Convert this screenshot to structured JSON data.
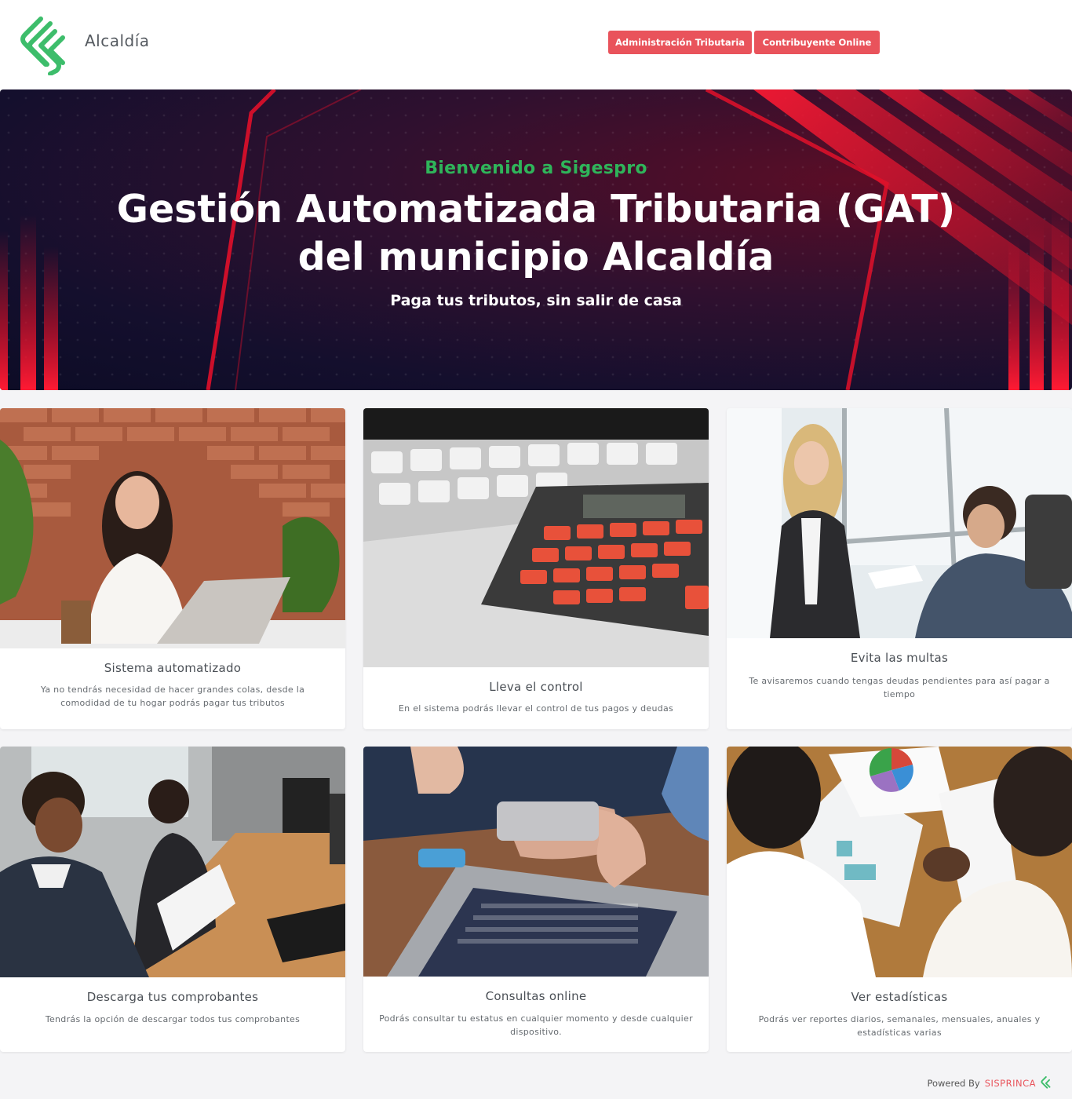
{
  "header": {
    "brand": "Alcaldía",
    "buttons": {
      "admin": "Administración Tributaria",
      "contrib": "Contribuyente Online"
    }
  },
  "hero": {
    "welcome": "Bienvenido a Sigespro",
    "title": "Gestión Automatizada Tributaria (GAT) del municipio Alcaldía",
    "tagline": "Paga tus tributos, sin salir de casa"
  },
  "cards": [
    {
      "title": "Sistema automatizado",
      "text": "Ya no tendrás necesidad de hacer grandes colas, desde la comodidad de tu hogar podrás pagar tus tributos"
    },
    {
      "title": "Lleva el control",
      "text": "En el sistema podrás llevar el control de tus pagos y deudas"
    },
    {
      "title": "Evita las multas",
      "text": "Te avisaremos cuando tengas deudas pendientes para así pagar a tiempo"
    },
    {
      "title": "Descarga tus comprobantes",
      "text": "Tendrás la opción de descargar todos tus comprobantes"
    },
    {
      "title": "Consultas online",
      "text": "Podrás consultar tu estatus en cualquier momento y desde cualquier dispositivo."
    },
    {
      "title": "Ver estadísticas",
      "text": "Podrás ver reportes diarios, semanales, mensuales, anuales y estadísticas varias"
    }
  ],
  "footer": {
    "powered": "Powered By",
    "company": "SISPRINCA"
  },
  "colors": {
    "accent": "#e9535b",
    "green": "#2fb55a",
    "hero_bg": "#140f2d"
  }
}
